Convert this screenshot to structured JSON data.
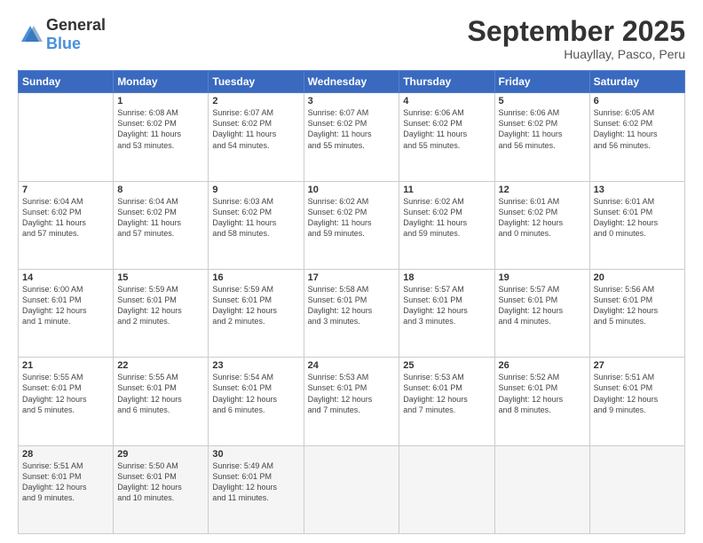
{
  "logo": {
    "general": "General",
    "blue": "Blue"
  },
  "header": {
    "month": "September 2025",
    "location": "Huayllay, Pasco, Peru"
  },
  "weekdays": [
    "Sunday",
    "Monday",
    "Tuesday",
    "Wednesday",
    "Thursday",
    "Friday",
    "Saturday"
  ],
  "weeks": [
    [
      {
        "day": "",
        "info": ""
      },
      {
        "day": "1",
        "info": "Sunrise: 6:08 AM\nSunset: 6:02 PM\nDaylight: 11 hours\nand 53 minutes."
      },
      {
        "day": "2",
        "info": "Sunrise: 6:07 AM\nSunset: 6:02 PM\nDaylight: 11 hours\nand 54 minutes."
      },
      {
        "day": "3",
        "info": "Sunrise: 6:07 AM\nSunset: 6:02 PM\nDaylight: 11 hours\nand 55 minutes."
      },
      {
        "day": "4",
        "info": "Sunrise: 6:06 AM\nSunset: 6:02 PM\nDaylight: 11 hours\nand 55 minutes."
      },
      {
        "day": "5",
        "info": "Sunrise: 6:06 AM\nSunset: 6:02 PM\nDaylight: 11 hours\nand 56 minutes."
      },
      {
        "day": "6",
        "info": "Sunrise: 6:05 AM\nSunset: 6:02 PM\nDaylight: 11 hours\nand 56 minutes."
      }
    ],
    [
      {
        "day": "7",
        "info": "Sunrise: 6:04 AM\nSunset: 6:02 PM\nDaylight: 11 hours\nand 57 minutes."
      },
      {
        "day": "8",
        "info": "Sunrise: 6:04 AM\nSunset: 6:02 PM\nDaylight: 11 hours\nand 57 minutes."
      },
      {
        "day": "9",
        "info": "Sunrise: 6:03 AM\nSunset: 6:02 PM\nDaylight: 11 hours\nand 58 minutes."
      },
      {
        "day": "10",
        "info": "Sunrise: 6:02 AM\nSunset: 6:02 PM\nDaylight: 11 hours\nand 59 minutes."
      },
      {
        "day": "11",
        "info": "Sunrise: 6:02 AM\nSunset: 6:02 PM\nDaylight: 11 hours\nand 59 minutes."
      },
      {
        "day": "12",
        "info": "Sunrise: 6:01 AM\nSunset: 6:02 PM\nDaylight: 12 hours\nand 0 minutes."
      },
      {
        "day": "13",
        "info": "Sunrise: 6:01 AM\nSunset: 6:01 PM\nDaylight: 12 hours\nand 0 minutes."
      }
    ],
    [
      {
        "day": "14",
        "info": "Sunrise: 6:00 AM\nSunset: 6:01 PM\nDaylight: 12 hours\nand 1 minute."
      },
      {
        "day": "15",
        "info": "Sunrise: 5:59 AM\nSunset: 6:01 PM\nDaylight: 12 hours\nand 2 minutes."
      },
      {
        "day": "16",
        "info": "Sunrise: 5:59 AM\nSunset: 6:01 PM\nDaylight: 12 hours\nand 2 minutes."
      },
      {
        "day": "17",
        "info": "Sunrise: 5:58 AM\nSunset: 6:01 PM\nDaylight: 12 hours\nand 3 minutes."
      },
      {
        "day": "18",
        "info": "Sunrise: 5:57 AM\nSunset: 6:01 PM\nDaylight: 12 hours\nand 3 minutes."
      },
      {
        "day": "19",
        "info": "Sunrise: 5:57 AM\nSunset: 6:01 PM\nDaylight: 12 hours\nand 4 minutes."
      },
      {
        "day": "20",
        "info": "Sunrise: 5:56 AM\nSunset: 6:01 PM\nDaylight: 12 hours\nand 5 minutes."
      }
    ],
    [
      {
        "day": "21",
        "info": "Sunrise: 5:55 AM\nSunset: 6:01 PM\nDaylight: 12 hours\nand 5 minutes."
      },
      {
        "day": "22",
        "info": "Sunrise: 5:55 AM\nSunset: 6:01 PM\nDaylight: 12 hours\nand 6 minutes."
      },
      {
        "day": "23",
        "info": "Sunrise: 5:54 AM\nSunset: 6:01 PM\nDaylight: 12 hours\nand 6 minutes."
      },
      {
        "day": "24",
        "info": "Sunrise: 5:53 AM\nSunset: 6:01 PM\nDaylight: 12 hours\nand 7 minutes."
      },
      {
        "day": "25",
        "info": "Sunrise: 5:53 AM\nSunset: 6:01 PM\nDaylight: 12 hours\nand 7 minutes."
      },
      {
        "day": "26",
        "info": "Sunrise: 5:52 AM\nSunset: 6:01 PM\nDaylight: 12 hours\nand 8 minutes."
      },
      {
        "day": "27",
        "info": "Sunrise: 5:51 AM\nSunset: 6:01 PM\nDaylight: 12 hours\nand 9 minutes."
      }
    ],
    [
      {
        "day": "28",
        "info": "Sunrise: 5:51 AM\nSunset: 6:01 PM\nDaylight: 12 hours\nand 9 minutes."
      },
      {
        "day": "29",
        "info": "Sunrise: 5:50 AM\nSunset: 6:01 PM\nDaylight: 12 hours\nand 10 minutes."
      },
      {
        "day": "30",
        "info": "Sunrise: 5:49 AM\nSunset: 6:01 PM\nDaylight: 12 hours\nand 11 minutes."
      },
      {
        "day": "",
        "info": ""
      },
      {
        "day": "",
        "info": ""
      },
      {
        "day": "",
        "info": ""
      },
      {
        "day": "",
        "info": ""
      }
    ]
  ]
}
